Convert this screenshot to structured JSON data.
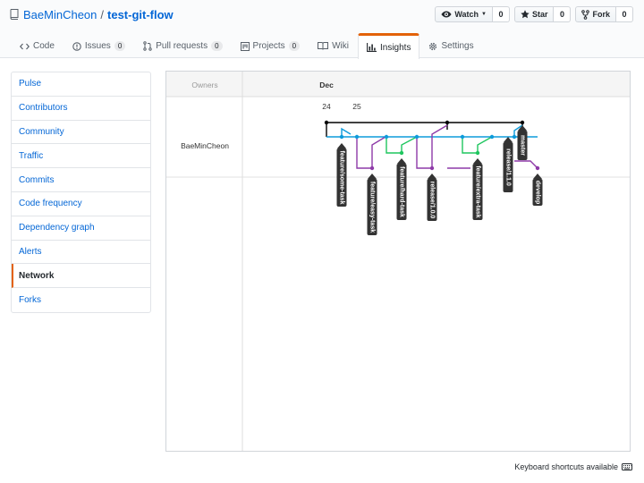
{
  "repo": {
    "owner": "BaeMinCheon",
    "separator": "/",
    "name": "test-git-flow"
  },
  "actions": [
    {
      "id": "watch",
      "label": "Watch",
      "icon": "eye-icon",
      "count": "0",
      "dropdown": true
    },
    {
      "id": "star",
      "label": "Star",
      "icon": "star-icon",
      "count": "0"
    },
    {
      "id": "fork",
      "label": "Fork",
      "icon": "fork-icon",
      "count": "0"
    }
  ],
  "tabs": [
    {
      "id": "code",
      "label": "Code",
      "icon": "code-icon"
    },
    {
      "id": "issues",
      "label": "Issues",
      "icon": "issue-icon",
      "count": "0"
    },
    {
      "id": "pull-requests",
      "label": "Pull requests",
      "icon": "pull-request-icon",
      "count": "0"
    },
    {
      "id": "projects",
      "label": "Projects",
      "icon": "project-icon",
      "count": "0"
    },
    {
      "id": "wiki",
      "label": "Wiki",
      "icon": "book-icon"
    },
    {
      "id": "insights",
      "label": "Insights",
      "icon": "graph-icon",
      "selected": true
    },
    {
      "id": "settings",
      "label": "Settings",
      "icon": "gear-icon"
    }
  ],
  "menu": [
    {
      "label": "Pulse"
    },
    {
      "label": "Contributors"
    },
    {
      "label": "Community"
    },
    {
      "label": "Traffic"
    },
    {
      "label": "Commits"
    },
    {
      "label": "Code frequency"
    },
    {
      "label": "Dependency graph"
    },
    {
      "label": "Alerts"
    },
    {
      "label": "Network",
      "selected": true
    },
    {
      "label": "Forks"
    }
  ],
  "network": {
    "owners_header": "Owners",
    "month": "Dec",
    "days": [
      "24",
      "25"
    ],
    "owner_name": "BaeMinCheon",
    "branches": [
      {
        "name": "feature/some-task",
        "color": "#0e9bdb"
      },
      {
        "name": "feature/easy-task",
        "color": "#8e3aa8"
      },
      {
        "name": "feature/hard-task",
        "color": "#1fc65f"
      },
      {
        "name": "release/1.0.0",
        "color": "#8e3aa8"
      },
      {
        "name": "feature/extra-task",
        "color": "#1fc65f"
      },
      {
        "name": "release/1.1.0",
        "color": "#0e9bdb"
      },
      {
        "name": "master",
        "color": "#000000"
      },
      {
        "name": "develop",
        "color": "#8e3aa8"
      }
    ]
  },
  "footer": {
    "shortcuts": "Keyboard shortcuts available"
  },
  "colors": {
    "link": "#0366d6",
    "accent": "#e36209",
    "border": "#e1e4e8"
  }
}
